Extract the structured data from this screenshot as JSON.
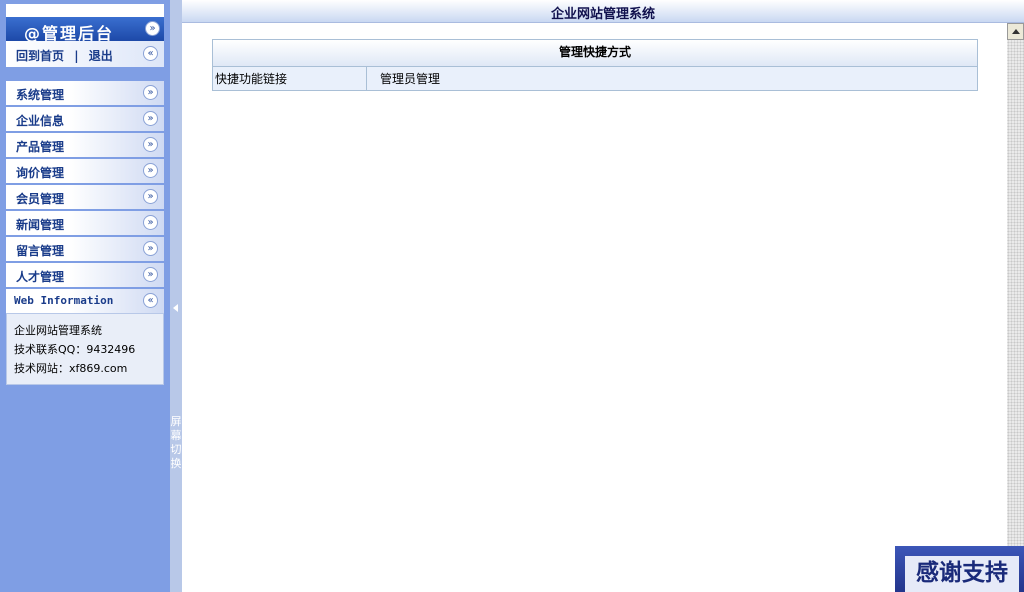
{
  "sidebar": {
    "header_title": "@管理后台",
    "links": {
      "home": "回到首页",
      "separator": "|",
      "logout": "退出"
    },
    "menu": [
      "系统管理",
      "企业信息",
      "产品管理",
      "询价管理",
      "会员管理",
      "新闻管理",
      "留言管理",
      "人才管理"
    ],
    "info": {
      "title": "Web Information",
      "lines": [
        "企业网站管理系统",
        "技术联系QQ：9432496",
        "技术网站：xf869.com"
      ]
    }
  },
  "splitter": {
    "label": "屏幕切换"
  },
  "main": {
    "title": "企业网站管理系统",
    "table": {
      "caption": "管理快捷方式",
      "row_label": "快捷功能链接",
      "link": "管理员管理"
    }
  },
  "badge": {
    "label": "感谢支持"
  },
  "icons": {
    "collapse": "double-chevron-left-icon",
    "expand": "double-chevron-down-icon"
  }
}
